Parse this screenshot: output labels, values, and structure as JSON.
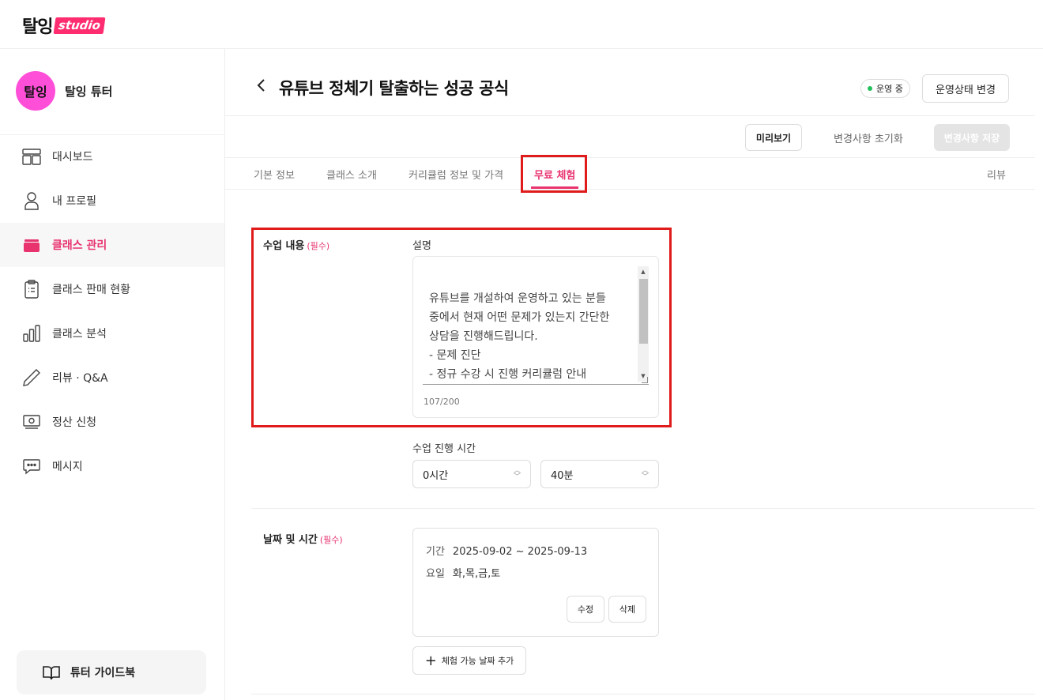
{
  "brand": {
    "logo_main": "탈잉",
    "logo_studio": "studio"
  },
  "sidebar": {
    "avatar_text": "탈잉",
    "profile_name": "탈잉 튜터",
    "items": [
      {
        "label": "대시보드",
        "icon": "dashboard-icon"
      },
      {
        "label": "내 프로필",
        "icon": "user-icon"
      },
      {
        "label": "클래스 관리",
        "icon": "folder-icon",
        "active": true
      },
      {
        "label": "클래스 판매 현황",
        "icon": "clipboard-icon"
      },
      {
        "label": "클래스 분석",
        "icon": "bar-chart-icon"
      },
      {
        "label": "리뷰 · Q&A",
        "icon": "pencil-icon"
      },
      {
        "label": "정산 신청",
        "icon": "cash-icon"
      },
      {
        "label": "메시지",
        "icon": "chat-bubble-icon"
      }
    ],
    "guide_label": "튜터 가이드북"
  },
  "header": {
    "title": "유튜브 정체기 탈출하는 성공 공식",
    "status": "운영 중",
    "status_button": "운영상태 변경"
  },
  "actions": {
    "preview": "미리보기",
    "reset": "변경사항 초기화",
    "save": "변경사항 저장"
  },
  "tabs": {
    "basic": "기본 정보",
    "intro": "클래스 소개",
    "curriculum": "커리큘럼 정보 및 가격",
    "free_trial": "무료 체험",
    "review": "리뷰"
  },
  "form": {
    "content_label": "수업 내용",
    "required": "(필수)",
    "desc_label": "설명",
    "desc_value": "유튜브를 개설하여 운영하고 있는 분들\n중에서 현재 어떤 문제가 있는지 간단한\n상담을 진행해드립니다.\n- 문제 진단\n- 정규 수강 시 진행 커리큘럼 안내",
    "char_count": "107/200",
    "duration_label": "수업 진행 시간",
    "hours_value": "0시간",
    "minutes_value": "40분",
    "date_label": "날짜 및 시간",
    "period_key": "기간",
    "period_value": "2025-09-02 ~ 2025-09-13",
    "days_key": "요일",
    "days_value": "화,목,금,토",
    "edit_button": "수정",
    "delete_button": "삭제",
    "add_button": "체험 가능 날짜 추가"
  },
  "colors": {
    "accent": "#e8336f",
    "highlight": "#e01b1b",
    "status_dot": "#21c05a",
    "avatar": "#ff4fd8"
  }
}
